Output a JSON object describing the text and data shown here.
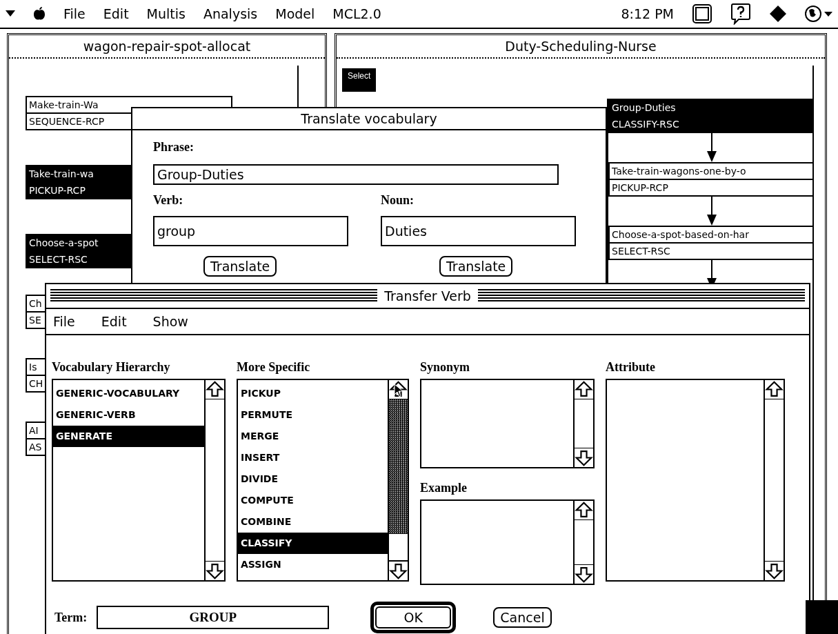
{
  "menu_bar": {
    "items": [
      "File",
      "Edit",
      "Multis",
      "Analysis",
      "Model",
      "MCL2.0"
    ],
    "clock": "8:12 PM"
  },
  "left_window": {
    "title": "wagon-repair-spot-allocat",
    "steps": [
      {
        "label": "Make-train-Wa",
        "operator": "SEQUENCE-RCP",
        "selected": false
      },
      {
        "label": "Take-train-wa",
        "operator": "PICKUP-RCP",
        "selected": true
      },
      {
        "label": "Choose-a-spot",
        "operator": "SELECT-RSC",
        "selected": true
      }
    ],
    "lower_steps": [
      {
        "label": "Ch",
        "operator": "SE",
        "selected": false
      },
      {
        "label": "Is",
        "operator": "CH",
        "selected": false
      },
      {
        "label": "AI",
        "operator": "AS",
        "selected": false
      }
    ]
  },
  "right_window": {
    "title": "Duty-Scheduling-Nurse",
    "select_button": "Select",
    "steps": [
      {
        "label": "Group-Duties",
        "operator": "CLASSIFY-RSC",
        "selected": true
      },
      {
        "label": "Take-train-wagons-one-by-o",
        "operator": "PICKUP-RCP",
        "selected": false
      },
      {
        "label": "Choose-a-spot-based-on-har",
        "operator": "SELECT-RSC",
        "selected": false
      }
    ]
  },
  "translate_dialog": {
    "title": "Translate vocabulary",
    "phrase_label": "Phrase:",
    "phrase": "Group-Duties",
    "verb_label": "Verb:",
    "verb": "group",
    "noun_label": "Noun:",
    "noun": "Duties",
    "buttons": [
      "Translate",
      "Translate"
    ]
  },
  "transfer_dialog": {
    "title": "Transfer Verb",
    "menu": [
      "File",
      "Edit",
      "Show"
    ],
    "lists": [
      {
        "label": "Vocabulary Hierarchy",
        "scrollbar_active": false,
        "items": [
          {
            "label": "GENERIC-VOCABULARY",
            "selected": false
          },
          {
            "label": "GENERIC-VERB",
            "selected": false
          },
          {
            "label": "GENERATE",
            "selected": true
          }
        ]
      },
      {
        "label": "More Specific",
        "scrollbar_active": true,
        "items": [
          {
            "label": "PICKUP",
            "selected": false
          },
          {
            "label": "PERMUTE",
            "selected": false
          },
          {
            "label": "MERGE",
            "selected": false
          },
          {
            "label": "INSERT",
            "selected": false
          },
          {
            "label": "DIVIDE",
            "selected": false
          },
          {
            "label": "COMPUTE",
            "selected": false
          },
          {
            "label": "COMBINE",
            "selected": false
          },
          {
            "label": "CLASSIFY",
            "selected": true
          },
          {
            "label": "ASSIGN",
            "selected": false
          }
        ]
      },
      {
        "label": "Synonym",
        "scrollbar_active": false
      },
      {
        "label": "Example",
        "scrollbar_active": false
      },
      {
        "label": "Attribute",
        "scrollbar_active": false
      }
    ],
    "term_label": "Term:",
    "term": "GROUP",
    "ok": "OK",
    "cancel": "Cancel"
  }
}
